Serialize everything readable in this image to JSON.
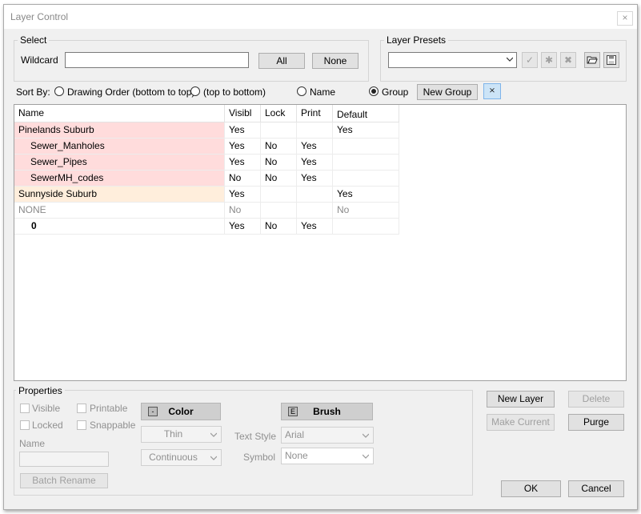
{
  "window": {
    "title": "Layer Control",
    "close_glyph": "×"
  },
  "select": {
    "group_label": "Select",
    "wildcard_label": "Wildcard",
    "wildcard_value": "",
    "all_label": "All",
    "none_label": "None"
  },
  "presets": {
    "group_label": "Layer Presets",
    "value": "",
    "apply_glyph": "✓",
    "new_glyph": "✱",
    "delete_glyph": "✖"
  },
  "sort": {
    "label": "Sort By:",
    "options": [
      "Drawing Order (bottom to top)",
      "(top to bottom)",
      "Name",
      "Group"
    ],
    "selected": "Group",
    "new_group_label": "New Group",
    "collapse_glyph": "⨯"
  },
  "grid": {
    "columns": [
      "Name",
      "Visibl",
      "Lock",
      "Print",
      "Default"
    ],
    "rows": [
      {
        "name": "Pinelands Suburb",
        "visible": "Yes",
        "lock": "",
        "print": "",
        "default": "Yes",
        "indent": false,
        "bold": false,
        "gray": false,
        "bg": "#ffdcdc"
      },
      {
        "name": "Sewer_Manholes",
        "visible": "Yes",
        "lock": "No",
        "print": "Yes",
        "default": "",
        "indent": true,
        "bold": false,
        "gray": false,
        "bg": "#ffdcdc"
      },
      {
        "name": "Sewer_Pipes",
        "visible": "Yes",
        "lock": "No",
        "print": "Yes",
        "default": "",
        "indent": true,
        "bold": false,
        "gray": false,
        "bg": "#ffdcdc"
      },
      {
        "name": "SewerMH_codes",
        "visible": "No",
        "lock": "No",
        "print": "Yes",
        "default": "",
        "indent": true,
        "bold": false,
        "gray": false,
        "bg": "#ffdcdc"
      },
      {
        "name": "Sunnyside Suburb",
        "visible": "Yes",
        "lock": "",
        "print": "",
        "default": "Yes",
        "indent": false,
        "bold": false,
        "gray": false,
        "bg": "#ffeedc"
      },
      {
        "name": "NONE",
        "visible": "No",
        "lock": "",
        "print": "",
        "default": "No",
        "indent": false,
        "bold": false,
        "gray": true,
        "bg": "#ffffff"
      },
      {
        "name": "0",
        "visible": "Yes",
        "lock": "No",
        "print": "Yes",
        "default": "",
        "indent": true,
        "bold": true,
        "gray": false,
        "bg": "#ffffff"
      }
    ]
  },
  "properties": {
    "group_label": "Properties",
    "visible_label": "Visible",
    "printable_label": "Printable",
    "locked_label": "Locked",
    "snappable_label": "Snappable",
    "name_label": "Name",
    "name_value": "",
    "batch_rename_label": "Batch Rename",
    "color_label": "Color",
    "color_key": "-",
    "brush_label": "Brush",
    "brush_key": "E",
    "line_weight": "Thin",
    "line_type": "Continuous",
    "text_style_label": "Text Style",
    "text_style_value": "Arial",
    "symbol_label": "Symbol",
    "symbol_value": "None"
  },
  "actions": {
    "new_layer": "New Layer",
    "delete": "Delete",
    "make_current": "Make Current",
    "purge": "Purge",
    "ok": "OK",
    "cancel": "Cancel"
  }
}
